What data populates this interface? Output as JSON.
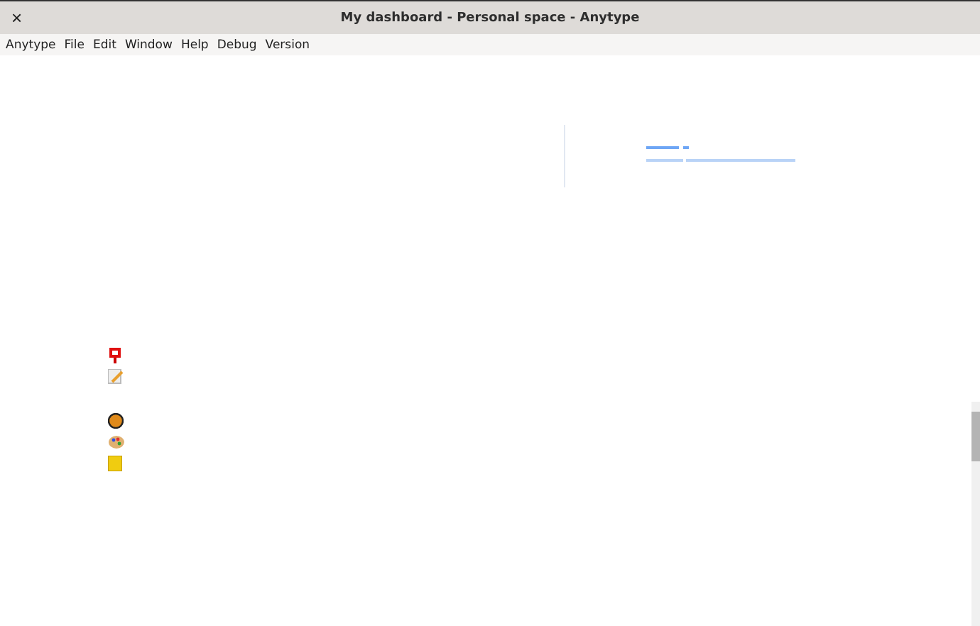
{
  "window": {
    "title": "My dashboard - Personal space - Anytype",
    "close": "×"
  },
  "menu": [
    "Anytype",
    "File",
    "Edit",
    "Window",
    "Help",
    "Debug",
    "Version"
  ]
}
